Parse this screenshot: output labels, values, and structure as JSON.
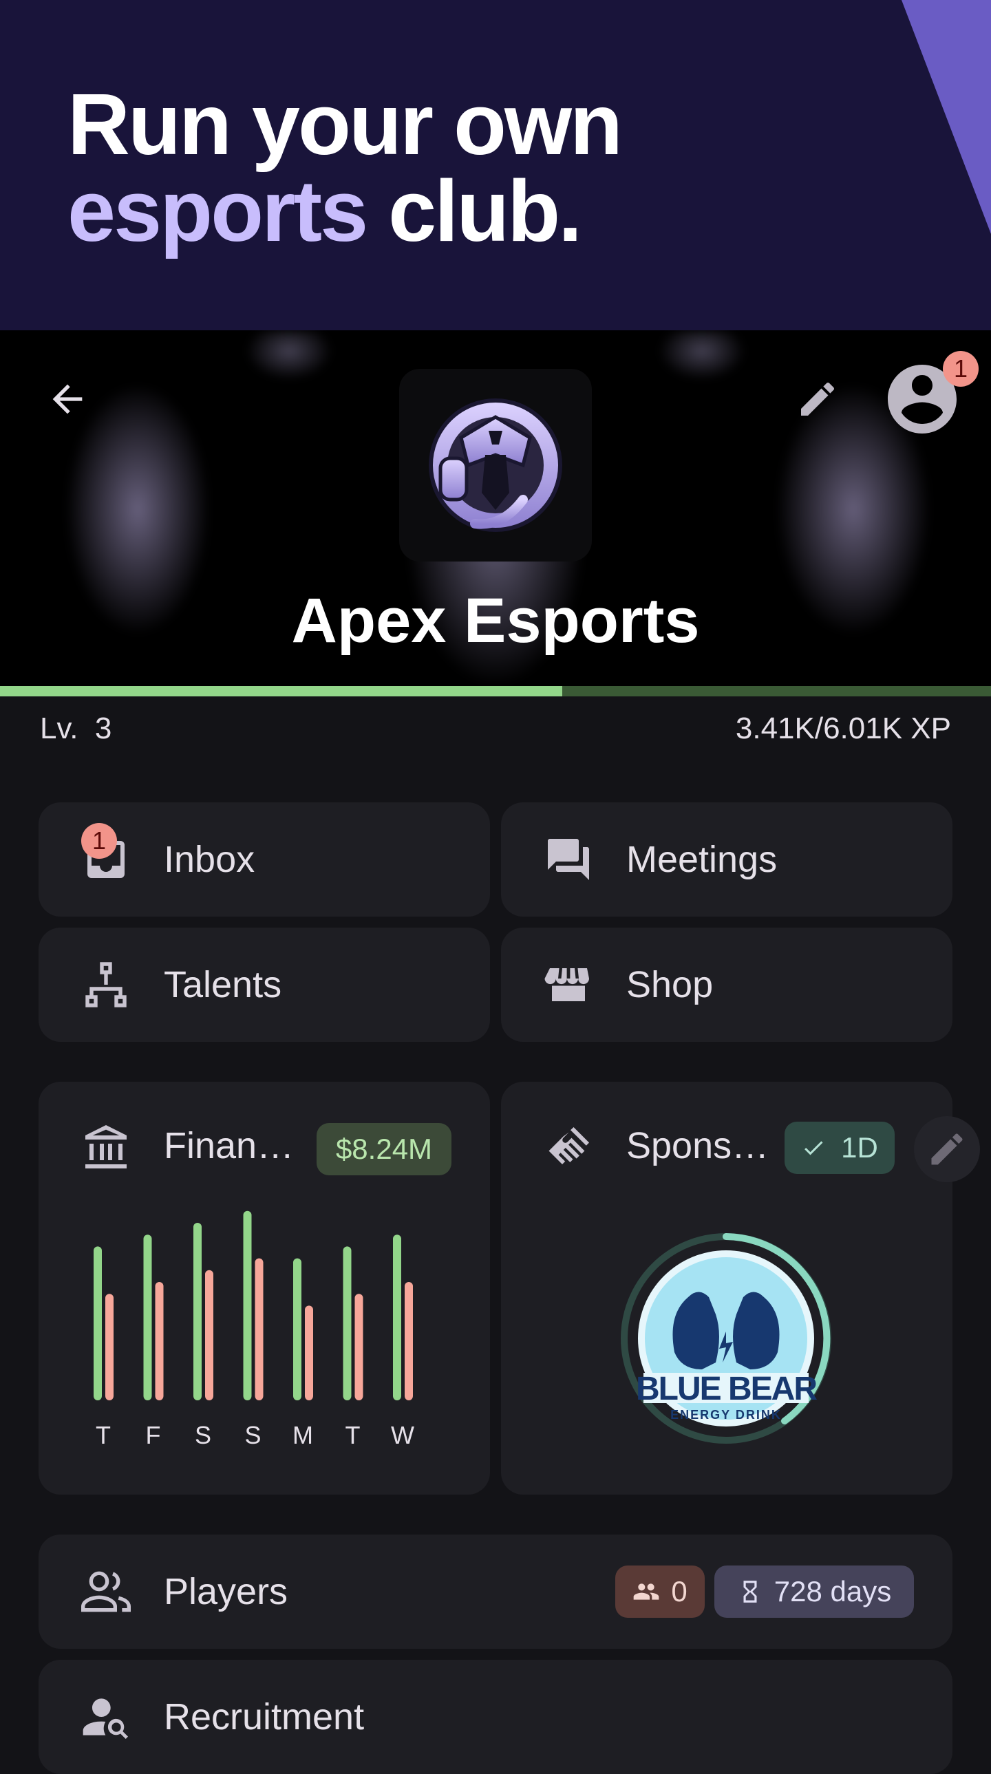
{
  "promo": {
    "line1": "Run your own",
    "line2_accent": "esports",
    "line2_rest": " club."
  },
  "header": {
    "team_name": "Apex Esports",
    "account_badge_count": "1"
  },
  "level": {
    "label": "Lv.  3",
    "xp_text": "3.41K/6.01K XP",
    "xp_current": 3410,
    "xp_max": 6010
  },
  "menu": {
    "inbox": {
      "label": "Inbox",
      "badge": "1"
    },
    "meetings": {
      "label": "Meetings"
    },
    "talents": {
      "label": "Talents"
    },
    "shop": {
      "label": "Shop"
    }
  },
  "finances": {
    "label": "Finan…",
    "balance": "$8.24M",
    "days": [
      "T",
      "F",
      "S",
      "S",
      "M",
      "T",
      "W"
    ],
    "income": [
      130,
      140,
      150,
      160,
      120,
      130,
      140
    ],
    "expenses": [
      90,
      100,
      110,
      120,
      80,
      90,
      100
    ]
  },
  "sponsors": {
    "label": "Spons…",
    "status": "1D",
    "logo_text_1": "BLUE BEAR",
    "logo_text_2": "ENERGY DRINK"
  },
  "players": {
    "label": "Players",
    "count": "0",
    "days": "728 days"
  },
  "recruitment": {
    "label": "Recruitment"
  },
  "colors": {
    "income": "#93d68a",
    "expenses": "#f7a79a",
    "accent": "#c8bdfc",
    "promo_bg": "#19143a"
  }
}
